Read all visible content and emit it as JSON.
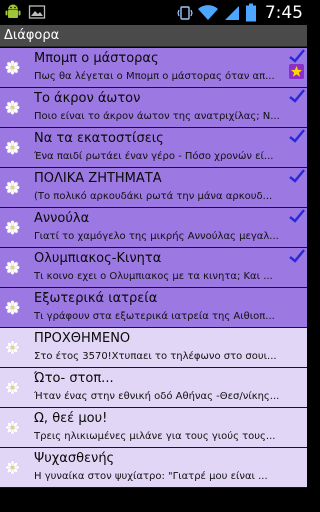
{
  "status_bar": {
    "time": "7:45",
    "left_icons": [
      "android-icon",
      "image-icon"
    ],
    "right_icons": [
      "vibrate-icon",
      "wifi-icon",
      "signal-icon",
      "battery-icon"
    ]
  },
  "app_bar": {
    "title": "Διάφορα"
  },
  "colors": {
    "read_row": "#9b78e2",
    "unread_row": "#e2d6f6",
    "check": "#2a2ad8"
  },
  "items": [
    {
      "title": "Μπομπ ο μάστορας",
      "subtitle": "Πως θα λέγεται ο Μπομπ ο μάστορας όταν απ...",
      "read": true,
      "checked": true,
      "starred": true
    },
    {
      "title": "Το άκρον άωτον",
      "subtitle": "Ποιο είναι το άκρον άωτον της ανατριχίλας; Ν...",
      "read": true,
      "checked": true,
      "starred": false
    },
    {
      "title": "Να τα εκατοστίσεις",
      "subtitle": "Ένα παιδί ρωτάει έναν γέρο - Πόσο χρονών εί...",
      "read": true,
      "checked": true,
      "starred": false
    },
    {
      "title": "ΠΟΛΙΚΑ ΖΗΤΗΜΑΤΑ",
      "subtitle": "(Το πολικό αρκουδάκι ρωτά την μάνα αρκουδ...",
      "read": true,
      "checked": true,
      "starred": false
    },
    {
      "title": "Αννούλα",
      "subtitle": "Γιατί το χαμόγελο της μικρής Αννούλας μεγαλ...",
      "read": true,
      "checked": true,
      "starred": false
    },
    {
      "title": "Ολυμπιακος-Κινητα",
      "subtitle": "Τι κοινο εχει ο Ολυμπιακος με τα κινητα; Και ...",
      "read": true,
      "checked": true,
      "starred": false
    },
    {
      "title": "Εξωτερικά ιατρεία",
      "subtitle": "Τι γράφουν στα εξωτερικά ιατρεία της Αιθιοπ...",
      "read": true,
      "checked": false,
      "starred": false
    },
    {
      "title": "ΠΡΟΧΘΗΜΕΝΟ",
      "subtitle": "Στο έτος 3570!Χτυπαει το τηλέφωνο στο σουι...",
      "read": false,
      "checked": false,
      "starred": false
    },
    {
      "title": "Ώτο- στοπ...",
      "subtitle": "Ήταν ένας στην εθνική οδό Αθήνας -Θεσ/νίκης...",
      "read": false,
      "checked": false,
      "starred": false
    },
    {
      "title": "Ω, θεέ μου!",
      "subtitle": "Τρεις ηλικιωμένες μιλάνε για τους γιούς τους...",
      "read": false,
      "checked": false,
      "starred": false
    },
    {
      "title": "Ψυχασθενής",
      "subtitle": "Η γυναίκα στον ψυχίατρο: \"Γιατρέ μου είναι ...",
      "read": false,
      "checked": false,
      "starred": false
    }
  ]
}
